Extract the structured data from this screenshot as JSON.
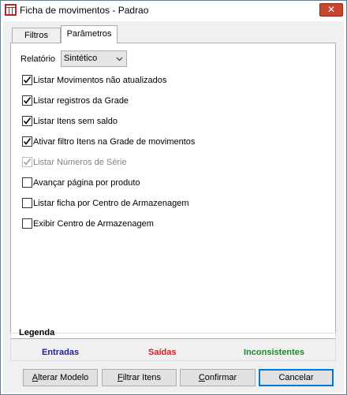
{
  "window": {
    "title": "Ficha de movimentos - Padrao",
    "close_glyph": "✕",
    "icon": "app-logo-icon"
  },
  "tabs": [
    {
      "label": "Filtros",
      "active": false
    },
    {
      "label": "Parâmetros",
      "active": true
    }
  ],
  "relatorio": {
    "label": "Relatório",
    "selected": "Sintético"
  },
  "checkboxes": [
    {
      "label": "Listar Movimentos não atualizados",
      "checked": true,
      "disabled": false
    },
    {
      "label": "Listar registros da Grade",
      "checked": true,
      "disabled": false
    },
    {
      "label": "Listar Itens sem saldo",
      "checked": true,
      "disabled": false
    },
    {
      "label": "Ativar filtro Itens na Grade de movimentos",
      "checked": true,
      "disabled": false
    },
    {
      "label": "Listar Números de Série",
      "checked": true,
      "disabled": true
    },
    {
      "label": "Avançar página por produto",
      "checked": false,
      "disabled": false
    },
    {
      "label": "Listar ficha por Centro de Armazenagem",
      "checked": false,
      "disabled": false
    },
    {
      "label": "Exibir Centro de Armazenagem",
      "checked": false,
      "disabled": false
    }
  ],
  "legend": {
    "title": "Legenda",
    "items": [
      {
        "label": "Entradas",
        "color": "#1f1f9b"
      },
      {
        "label": "Saídas",
        "color": "#e0161b"
      },
      {
        "label": "Inconsistentes",
        "color": "#1d8a2e"
      }
    ]
  },
  "buttons": {
    "alterar_first": "A",
    "alterar_rest": "lterar Modelo",
    "filtrar_first": "F",
    "filtrar_rest": "iltrar Itens",
    "confirmar_first": "C",
    "confirmar_rest": "onfirmar",
    "cancelar": "Cancelar"
  }
}
